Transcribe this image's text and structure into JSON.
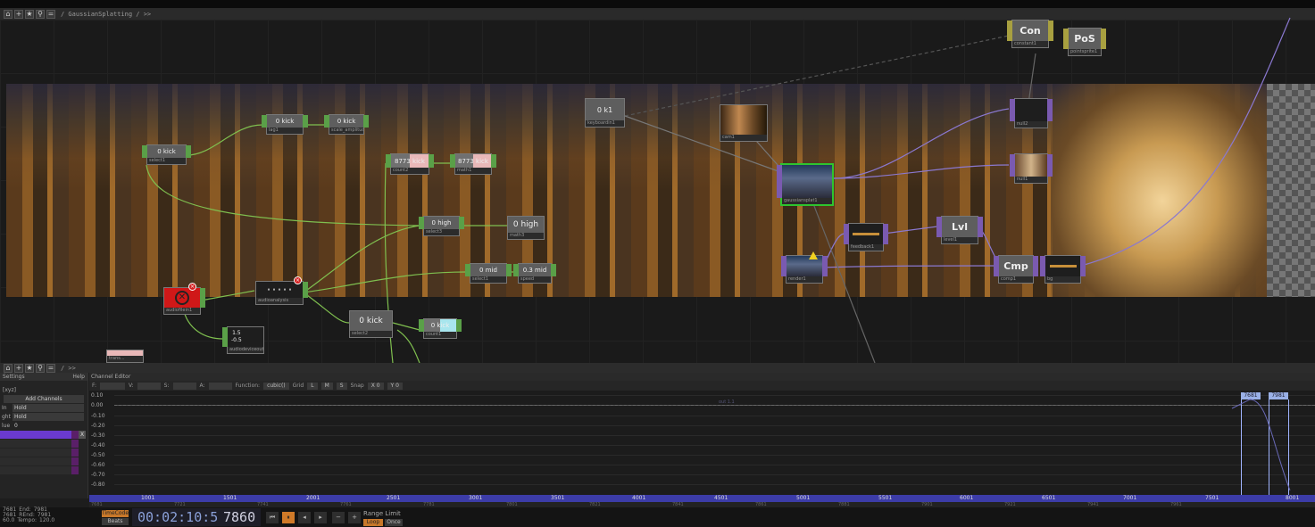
{
  "network": {
    "path": "/ GaussianSplatting / >>",
    "nodes": {
      "select1": {
        "face": "0 kick",
        "label": "select1"
      },
      "lag1": {
        "face": "0 kick",
        "label": "lag1"
      },
      "scale": {
        "face": "0 kick",
        "label": "scale_amplitude1"
      },
      "count2": {
        "face": "8773 kick",
        "label": "count2"
      },
      "math1": {
        "face": "8773 kick",
        "label": "math1"
      },
      "select3": {
        "face": "0 high",
        "label": "select3"
      },
      "math3": {
        "face": "0 high",
        "label": "math3"
      },
      "select_mid": {
        "face": "0 mid",
        "label": "select1"
      },
      "speed": {
        "face": "0.3 mid",
        "label": "speed"
      },
      "audioanalysis": {
        "label": "audioanalysis"
      },
      "audiofilein": {
        "label": "audiofilein1"
      },
      "audiodevice": {
        "face": "1.5\n-0.5",
        "label": "audiodeviceout2"
      },
      "select2": {
        "face": "0 kick",
        "label": "select2"
      },
      "count1": {
        "face": "0 kick",
        "label": "count1"
      },
      "keyboard": {
        "face": "0 k1",
        "label": "keyboardin1"
      },
      "cam1": {
        "label": "cam1"
      },
      "gaussian": {
        "label": "gaussiansplat1"
      },
      "constant": {
        "face": "Con",
        "label": "constant1"
      },
      "pointsprite": {
        "face": "PoS",
        "label": "pointsprite1"
      },
      "null2": {
        "label": "null2"
      },
      "null1": {
        "label": "null1"
      },
      "render1": {
        "label": "render1"
      },
      "feedback": {
        "label": "feedback1"
      },
      "level1": {
        "face": "Lvl",
        "label": "level1"
      },
      "comp1": {
        "face": "Cmp",
        "label": "comp1"
      },
      "bg": {
        "label": "bg"
      },
      "nodeLeft": {
        "face": "",
        "label": "trans..."
      }
    }
  },
  "lower": {
    "path": "/ >>",
    "settings": "Settings",
    "help": "Help",
    "xyz": "[xyz]",
    "add_channels": "Add Channels",
    "fields": [
      {
        "k": "In",
        "v": "Hold"
      },
      {
        "k": "ght",
        "v": "Hold"
      },
      {
        "k": "lue",
        "v": "0"
      }
    ],
    "channel_editor": "Channel Editor",
    "toolbar": {
      "f": "F:",
      "v": "V:",
      "s": "S:",
      "a": "A:",
      "function": "Function:",
      "function_value": "cubic()",
      "grid": "Grid",
      "g_l": "L",
      "g_m": "M",
      "g_s": "S",
      "snap": "Snap",
      "snap_x": "X 0",
      "snap_y": "Y 0"
    },
    "y_ticks": [
      "0.10",
      "0.00",
      "-0.10",
      "-0.20",
      "-0.30",
      "-0.40",
      "-0.50",
      "-0.60",
      "-0.70",
      "-0.80"
    ],
    "graph_tag": "out 1.1",
    "ruler": [
      "1001",
      "1501",
      "2001",
      "2501",
      "3001",
      "3501",
      "4001",
      "4501",
      "5001",
      "5501",
      "6001",
      "6501",
      "7001",
      "7501",
      "8001"
    ],
    "ruler2": [
      "7681",
      "7721",
      "7741",
      "7761",
      "7781",
      "7801",
      "7821",
      "7841",
      "7861",
      "7881",
      "7901",
      "7921",
      "7941",
      "7961"
    ],
    "markers": [
      "7681",
      "7981"
    ]
  },
  "transport": {
    "start_label": "Start:",
    "start": "7681",
    "end_label": "End:",
    "end": "7981",
    "rstart_label": "RStart:",
    "rstart": "7681",
    "rend_label": "REnd:",
    "rend": "7981",
    "fps_label": "FPS:",
    "fps": "60.0",
    "tempo_label": "Tempo:",
    "tempo": "120.0",
    "tsig_label": "T Sig:",
    "tsig": "4   4",
    "timecode": "TimeCode",
    "beats": "Beats",
    "time": "00:02:10:59",
    "frame": "7860",
    "range_limit": "Range Limit",
    "loop": "Loop",
    "once": "Once"
  }
}
